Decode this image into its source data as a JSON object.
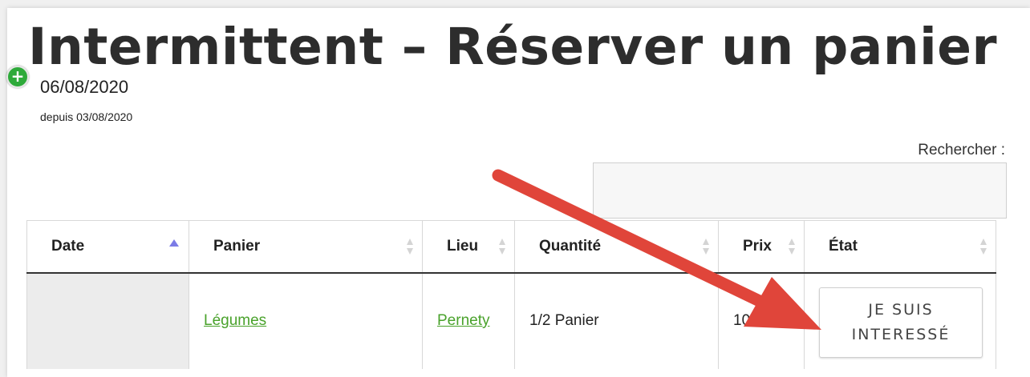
{
  "page": {
    "title": "Intermittent – Réserver un panier"
  },
  "search": {
    "label": "Rechercher :",
    "value": ""
  },
  "table": {
    "columns": [
      "Date",
      "Panier",
      "Lieu",
      "Quantité",
      "Prix",
      "État"
    ],
    "rows": [
      {
        "date": "06/08/2020",
        "since": "depuis 03/08/2020",
        "panier": "Légumes",
        "lieu": "Pernety",
        "quantite": "1/2 Panier",
        "prix": "10",
        "etat_button": "JE SUIS INTERESSÉ"
      }
    ]
  },
  "colors": {
    "link": "#49a22b",
    "arrow": "#e0453a",
    "sort_active": "#7b7be6",
    "expand_icon": "#2eaa3a"
  },
  "icons": {
    "expand": "plus-circle-icon",
    "sort_active": "sort-ascending-icon",
    "sort_inactive": "sort-both-icon",
    "annotation": "red-arrow-annotation"
  }
}
